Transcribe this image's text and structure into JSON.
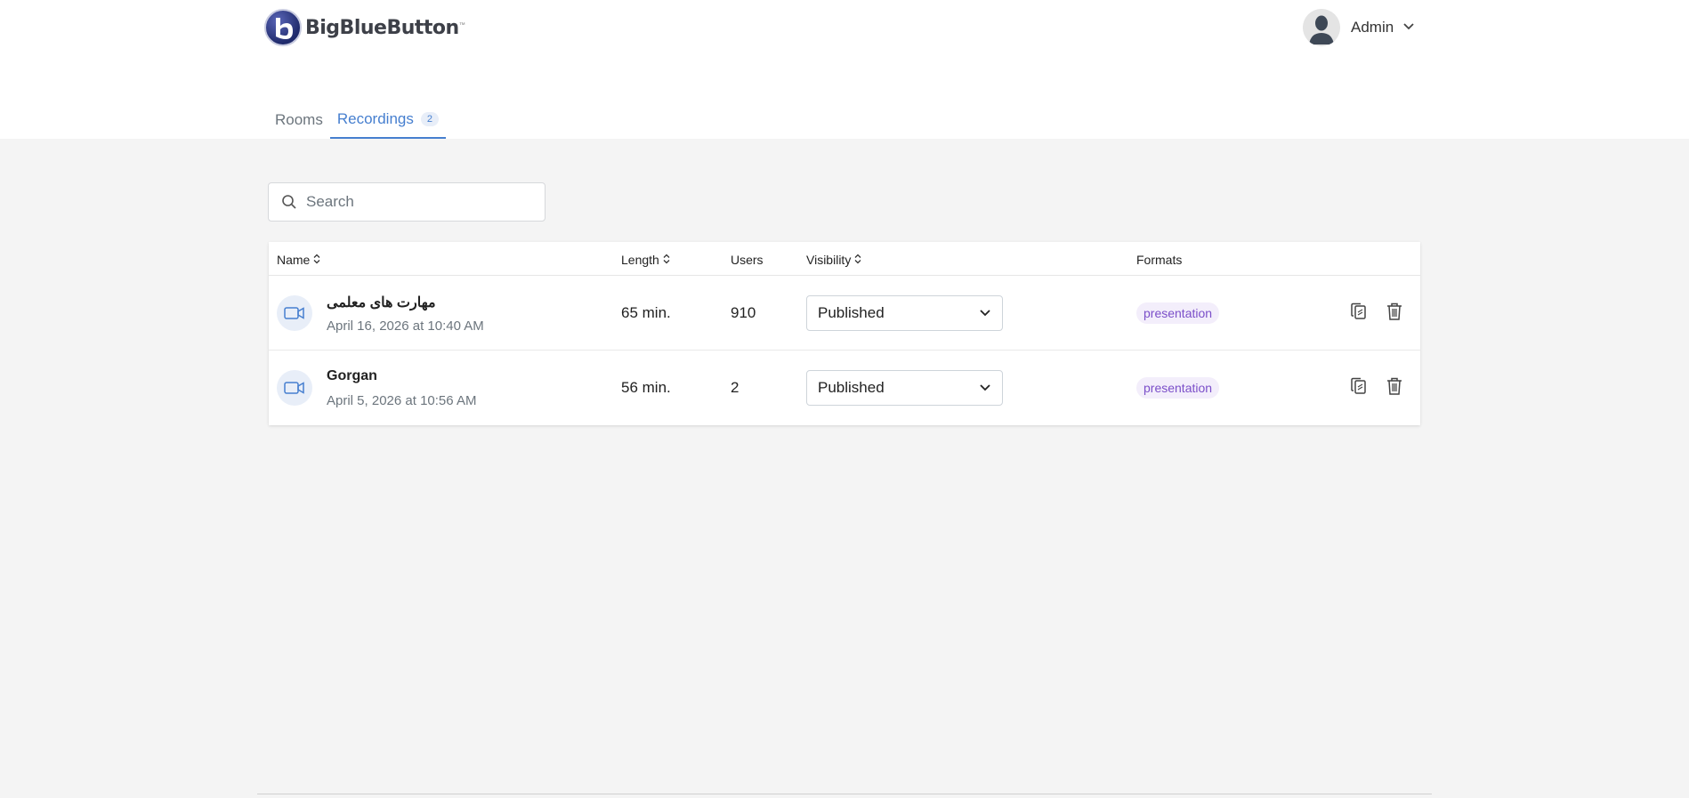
{
  "header": {
    "logo_text": "BigBlueButton",
    "logo_tm": "™",
    "user_name": "Admin"
  },
  "tabs": [
    {
      "label": "Rooms",
      "active": false
    },
    {
      "label": "Recordings",
      "active": true,
      "badge": "2"
    }
  ],
  "search": {
    "placeholder": "Search",
    "value": ""
  },
  "table": {
    "columns": {
      "name": "Name",
      "length": "Length",
      "users": "Users",
      "visibility": "Visibility",
      "formats": "Formats"
    },
    "rows": [
      {
        "name": "مهارت های معلمی",
        "date": "April 16, 2026 at 10:40 AM",
        "length": "65 min.",
        "users": "910",
        "visibility": "Published",
        "format": "presentation"
      },
      {
        "name": "Gorgan",
        "date": "April 5, 2026 at 10:56 AM",
        "length": "56 min.",
        "users": "2",
        "visibility": "Published",
        "format": "presentation"
      }
    ]
  },
  "colors": {
    "accent": "#467fcf",
    "background": "#f4f4f4",
    "format_badge": "#7b4fc9"
  },
  "icons": [
    "search-icon",
    "video-icon",
    "chevron-down-icon",
    "sort-icon",
    "copy-icon",
    "trash-icon",
    "user-avatar"
  ]
}
